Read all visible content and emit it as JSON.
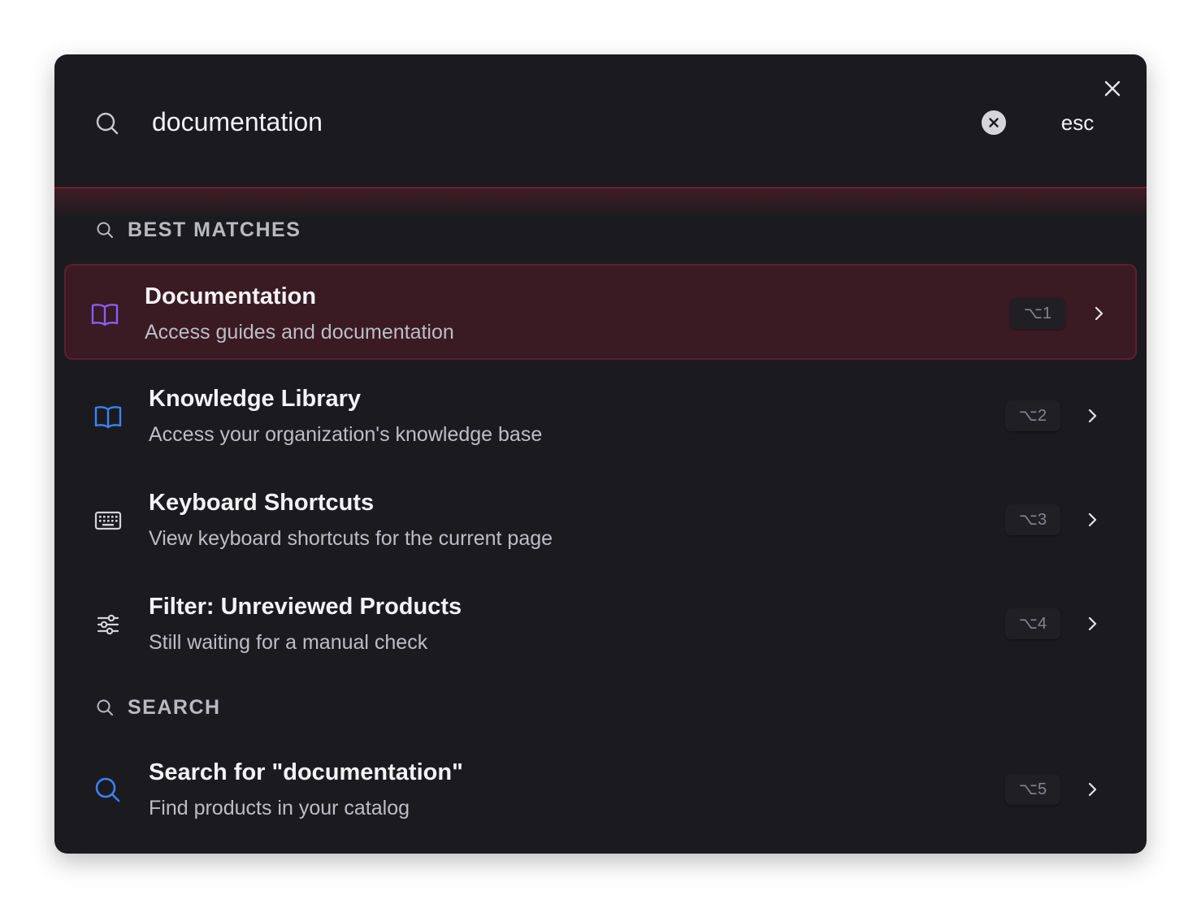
{
  "search": {
    "query": "documentation",
    "placeholder": "",
    "esc_label": "esc"
  },
  "sections": {
    "best_matches": {
      "label": "BEST MATCHES"
    },
    "search": {
      "label": "SEARCH"
    }
  },
  "items": [
    {
      "title": "Documentation",
      "subtitle": "Access guides and documentation",
      "shortcut": "⌥1",
      "icon": "book-open-icon",
      "icon_color": "#8b5cf6",
      "active": true
    },
    {
      "title": "Knowledge Library",
      "subtitle": "Access your organization's knowledge base",
      "shortcut": "⌥2",
      "icon": "book-open-icon",
      "icon_color": "#3b82f6",
      "active": false
    },
    {
      "title": "Keyboard Shortcuts",
      "subtitle": "View keyboard shortcuts for the current page",
      "shortcut": "⌥3",
      "icon": "keyboard-icon",
      "icon_color": "#d4d4d8",
      "active": false
    },
    {
      "title": "Filter: Unreviewed Products",
      "subtitle": "Still waiting for a manual check",
      "shortcut": "⌥4",
      "icon": "sliders-icon",
      "icon_color": "#d4d4d8",
      "active": false
    },
    {
      "title": "Search for \"documentation\"",
      "subtitle": "Find products in your catalog",
      "shortcut": "⌥5",
      "icon": "search-icon",
      "icon_color": "#3b82f6",
      "active": false
    }
  ],
  "colors": {
    "background": "#1b1b1f",
    "accent": "#6e1d2e",
    "active_row": "#3a1a23"
  }
}
